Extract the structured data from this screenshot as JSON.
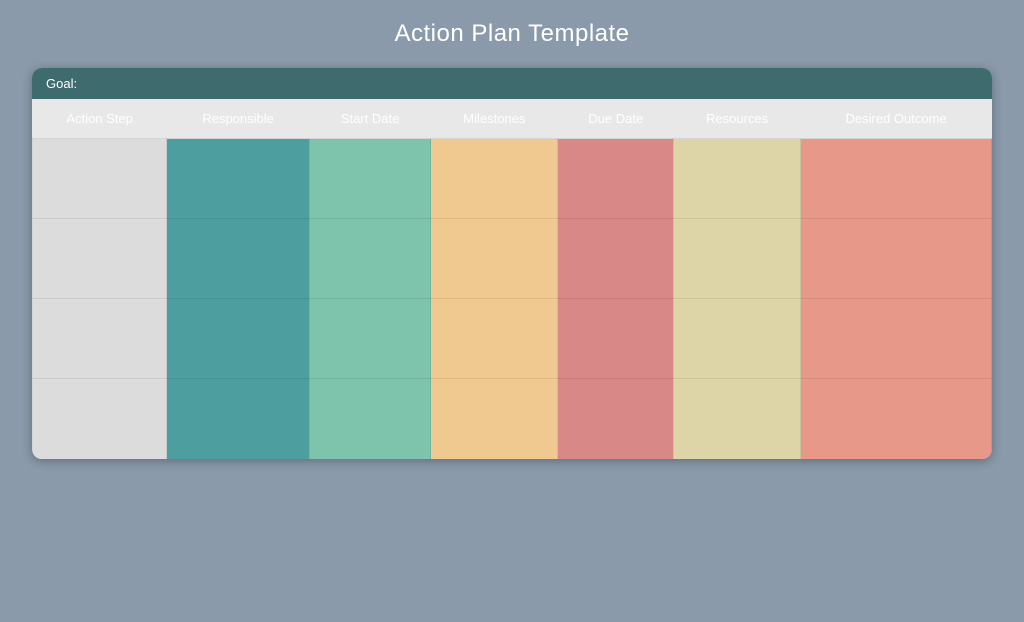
{
  "page": {
    "title": "Action Plan Template"
  },
  "goal_bar": {
    "label": "Goal:"
  },
  "columns": [
    {
      "id": "action-step",
      "label": "Action Step",
      "class": "col-action-step",
      "cell_class": "cell-action-step"
    },
    {
      "id": "responsible",
      "label": "Responsible",
      "class": "col-responsible",
      "cell_class": "cell-responsible"
    },
    {
      "id": "start-date",
      "label": "Start Date",
      "class": "col-start-date",
      "cell_class": "cell-start-date"
    },
    {
      "id": "milestones",
      "label": "Milestones",
      "class": "col-milestones",
      "cell_class": "cell-milestones"
    },
    {
      "id": "due-date",
      "label": "Due Date",
      "class": "col-due-date",
      "cell_class": "cell-due-date"
    },
    {
      "id": "resources",
      "label": "Resources",
      "class": "col-resources",
      "cell_class": "cell-resources"
    },
    {
      "id": "desired-outcome",
      "label": "Desired Outcome",
      "class": "col-desired-outcome",
      "cell_class": "cell-desired-outcome"
    }
  ],
  "rows": [
    {
      "id": "row-1"
    },
    {
      "id": "row-2"
    },
    {
      "id": "row-3"
    },
    {
      "id": "row-4"
    }
  ]
}
